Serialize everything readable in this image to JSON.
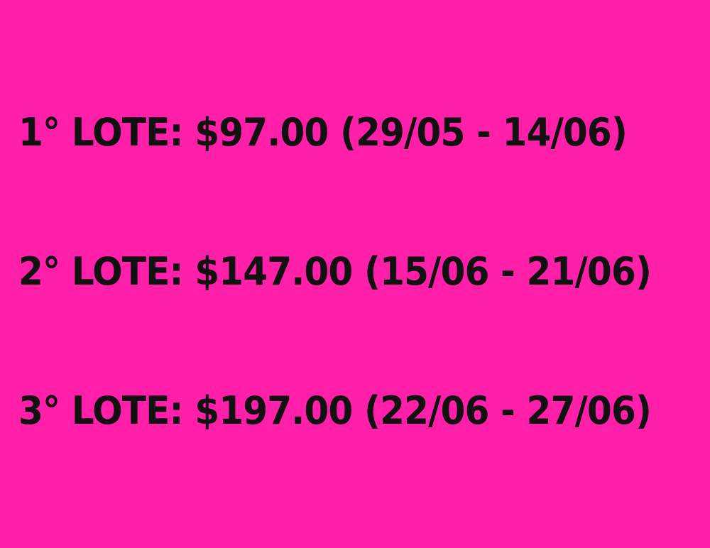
{
  "background_color": "#FF1FA8",
  "text_color": "#111111",
  "lotes": [
    {
      "text": "1° LOTE: $97.00 (29/05 - 14/06)"
    },
    {
      "text": "2° LOTE: $147.00 (15/06 - 21/06)"
    },
    {
      "text": "3° LOTE: $197.00 (22/06 - 27/06)"
    }
  ]
}
